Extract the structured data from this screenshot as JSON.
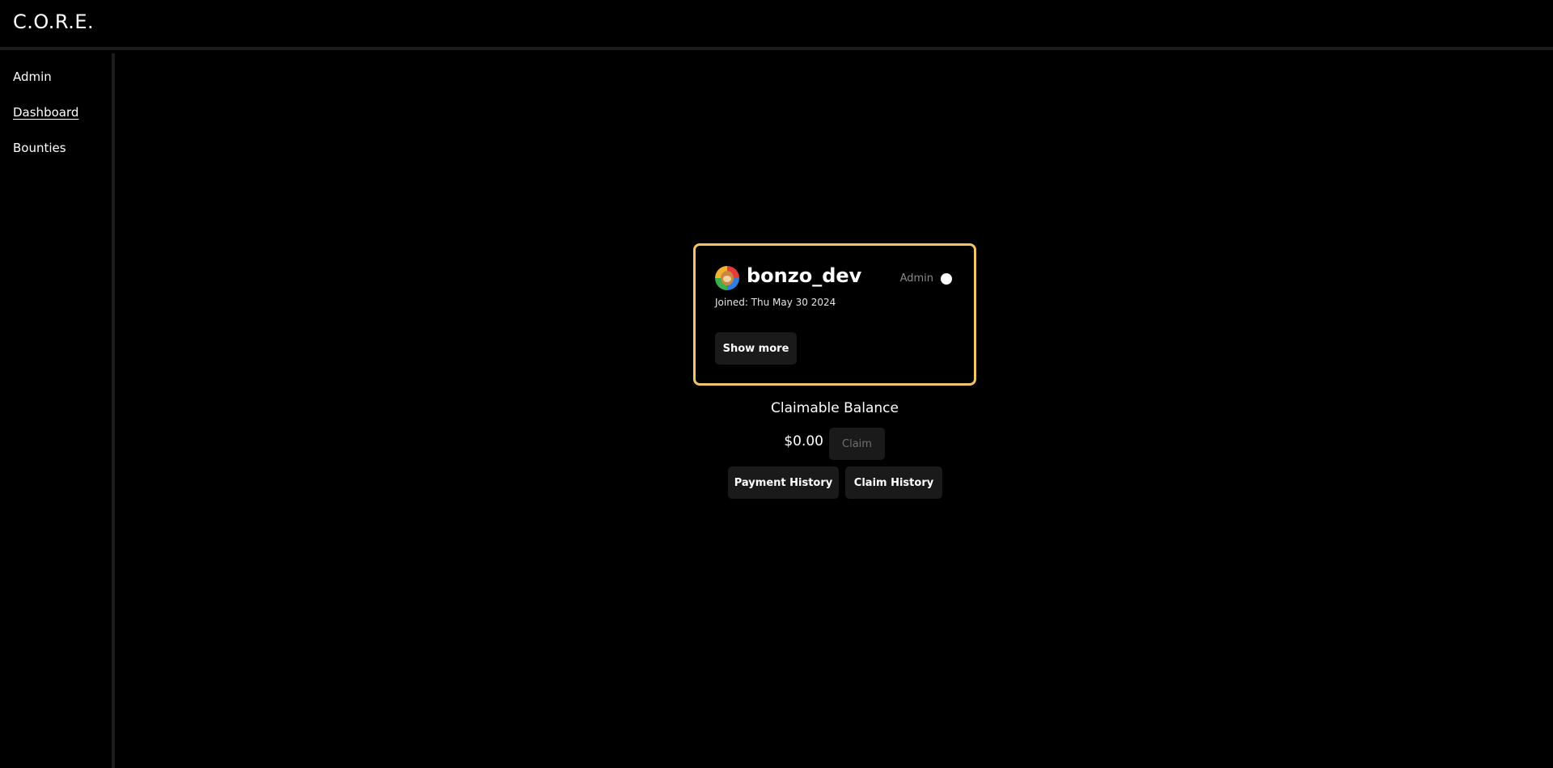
{
  "header": {
    "brand": "C.O.R.E."
  },
  "sidebar": {
    "items": [
      {
        "label": "Admin"
      },
      {
        "label": "Dashboard",
        "active": true
      },
      {
        "label": "Bounties"
      }
    ]
  },
  "profile": {
    "username": "bonzo_dev",
    "role": "Admin",
    "joined": "Joined: Thu May 30 2024",
    "show_more_label": "Show more"
  },
  "balance": {
    "title": "Claimable Balance",
    "amount": "$0.00",
    "claim_label": "Claim",
    "payment_history_label": "Payment History",
    "claim_history_label": "Claim History"
  },
  "colors": {
    "background": "#000000",
    "card_border": "#f3c466",
    "button_bg": "#1a1a1a",
    "divider": "#1c1c1c"
  }
}
